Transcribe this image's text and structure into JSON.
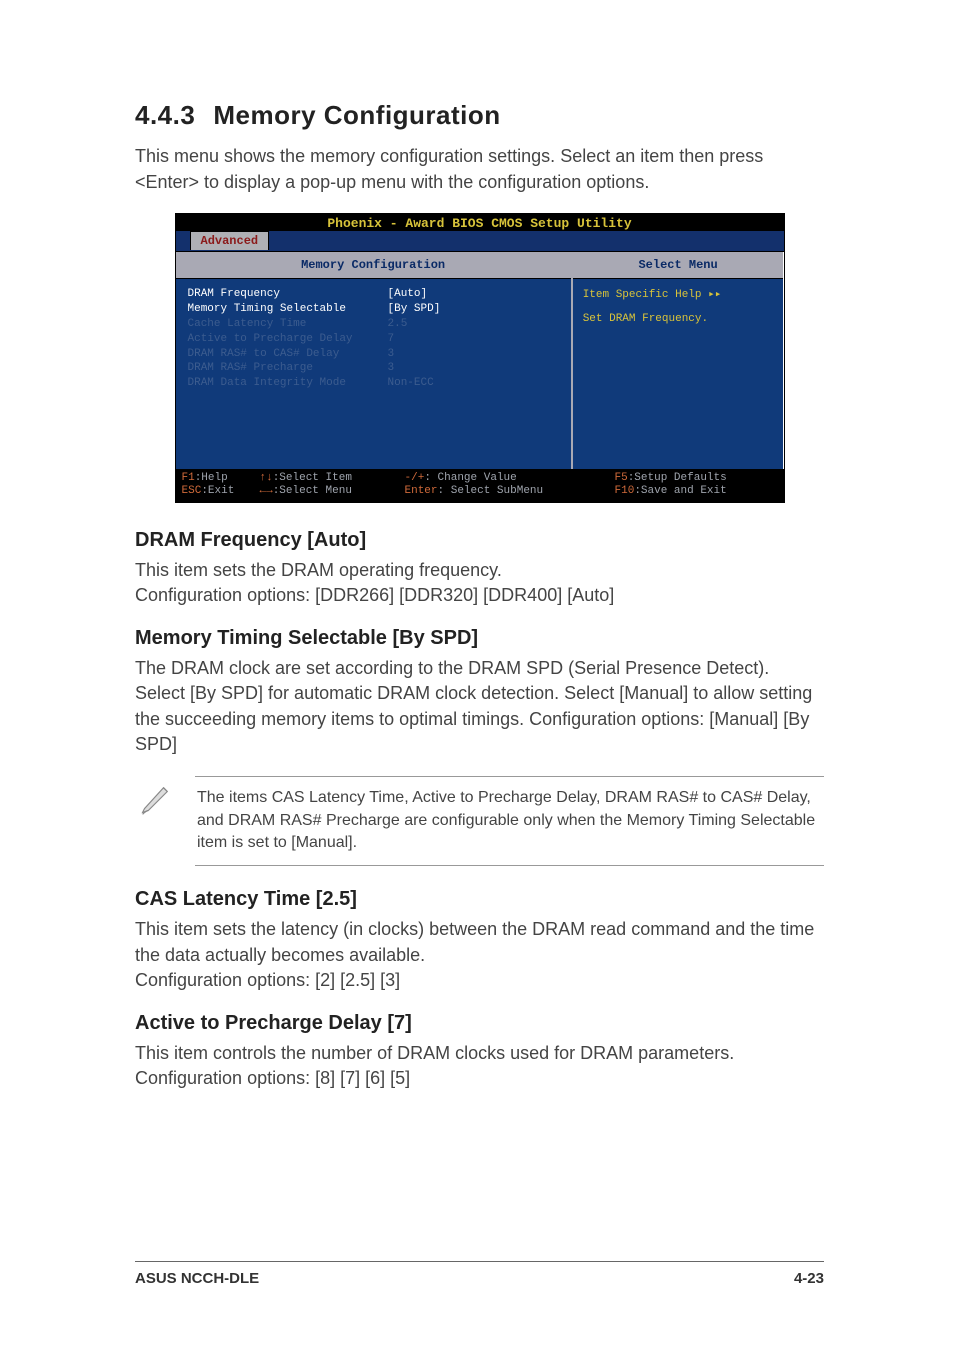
{
  "section": {
    "number": "4.4.3",
    "title": "Memory Configuration"
  },
  "intro": "This menu shows the memory configuration settings. Select an item then press <Enter> to display a pop-up menu with the configuration options.",
  "bios": {
    "title": "Phoenix - Award BIOS CMOS Setup Utility",
    "tab": "Advanced",
    "left_header": "Memory Configuration",
    "right_header": "Select Menu",
    "rows": [
      {
        "label": "DRAM Frequency",
        "value": "[Auto]",
        "style": "highlight"
      },
      {
        "label": "Memory Timing Selectable",
        "value": "[By SPD]",
        "style": "highlight"
      },
      {
        "label": "Cache Latency Time",
        "value": "2.5",
        "style": "dim"
      },
      {
        "label": "Active to Precharge Delay",
        "value": "7",
        "style": "dim"
      },
      {
        "label": "DRAM RAS# to CAS# Delay",
        "value": "3",
        "style": "dim"
      },
      {
        "label": "DRAM RAS# Precharge",
        "value": "3",
        "style": "dim"
      },
      {
        "label": "DRAM Data Integrity Mode",
        "value": "Non-ECC",
        "style": "dim"
      }
    ],
    "help_title": "Item Specific Help ▸▸",
    "help_body": "Set DRAM Frequency.",
    "footer": {
      "r1": {
        "k1": "F1",
        "l1": ":Help",
        "k2": "↑↓",
        "l2": ":Select Item",
        "k3": "-/+",
        "l3": ": Change Value",
        "k4": "F5",
        "l4": ":Setup Defaults"
      },
      "r2": {
        "k1": "ESC",
        "l1": ":Exit",
        "k2": "←→",
        "l2": ":Select Menu",
        "k3": "Enter",
        "l3": ": Select SubMenu",
        "k4": "F10",
        "l4": ":Save and Exit"
      }
    }
  },
  "sub": {
    "dram_freq": {
      "heading": "DRAM Frequency [Auto]",
      "p1": "This item sets the DRAM operating frequency.",
      "p2": "Configuration options: [DDR266] [DDR320] [DDR400] [Auto]"
    },
    "mem_timing": {
      "heading": "Memory Timing Selectable [By SPD]",
      "p1": "The DRAM clock are set according to the DRAM SPD (Serial Presence Detect). Select [By SPD] for automatic DRAM clock detection. Select [Manual] to allow setting the succeeding memory items to optimal timings. Configuration options: [Manual] [By SPD]"
    },
    "note": "The items CAS Latency Time, Active to Precharge Delay, DRAM RAS# to CAS# Delay, and DRAM RAS# Precharge are configurable only when the Memory Timing Selectable item is set to [Manual].",
    "cas": {
      "heading": "CAS Latency Time [2.5]",
      "p1": "This item sets the latency (in clocks) between the DRAM read command and the time the data actually becomes available.",
      "p2": "Configuration options: [2] [2.5] [3]"
    },
    "active": {
      "heading": "Active to Precharge Delay [7]",
      "p1": "This item controls the number of DRAM clocks used for DRAM parameters. Configuration options: [8] [7] [6] [5]"
    }
  },
  "footer": {
    "left": "ASUS NCCH-DLE",
    "right": "4-23"
  }
}
